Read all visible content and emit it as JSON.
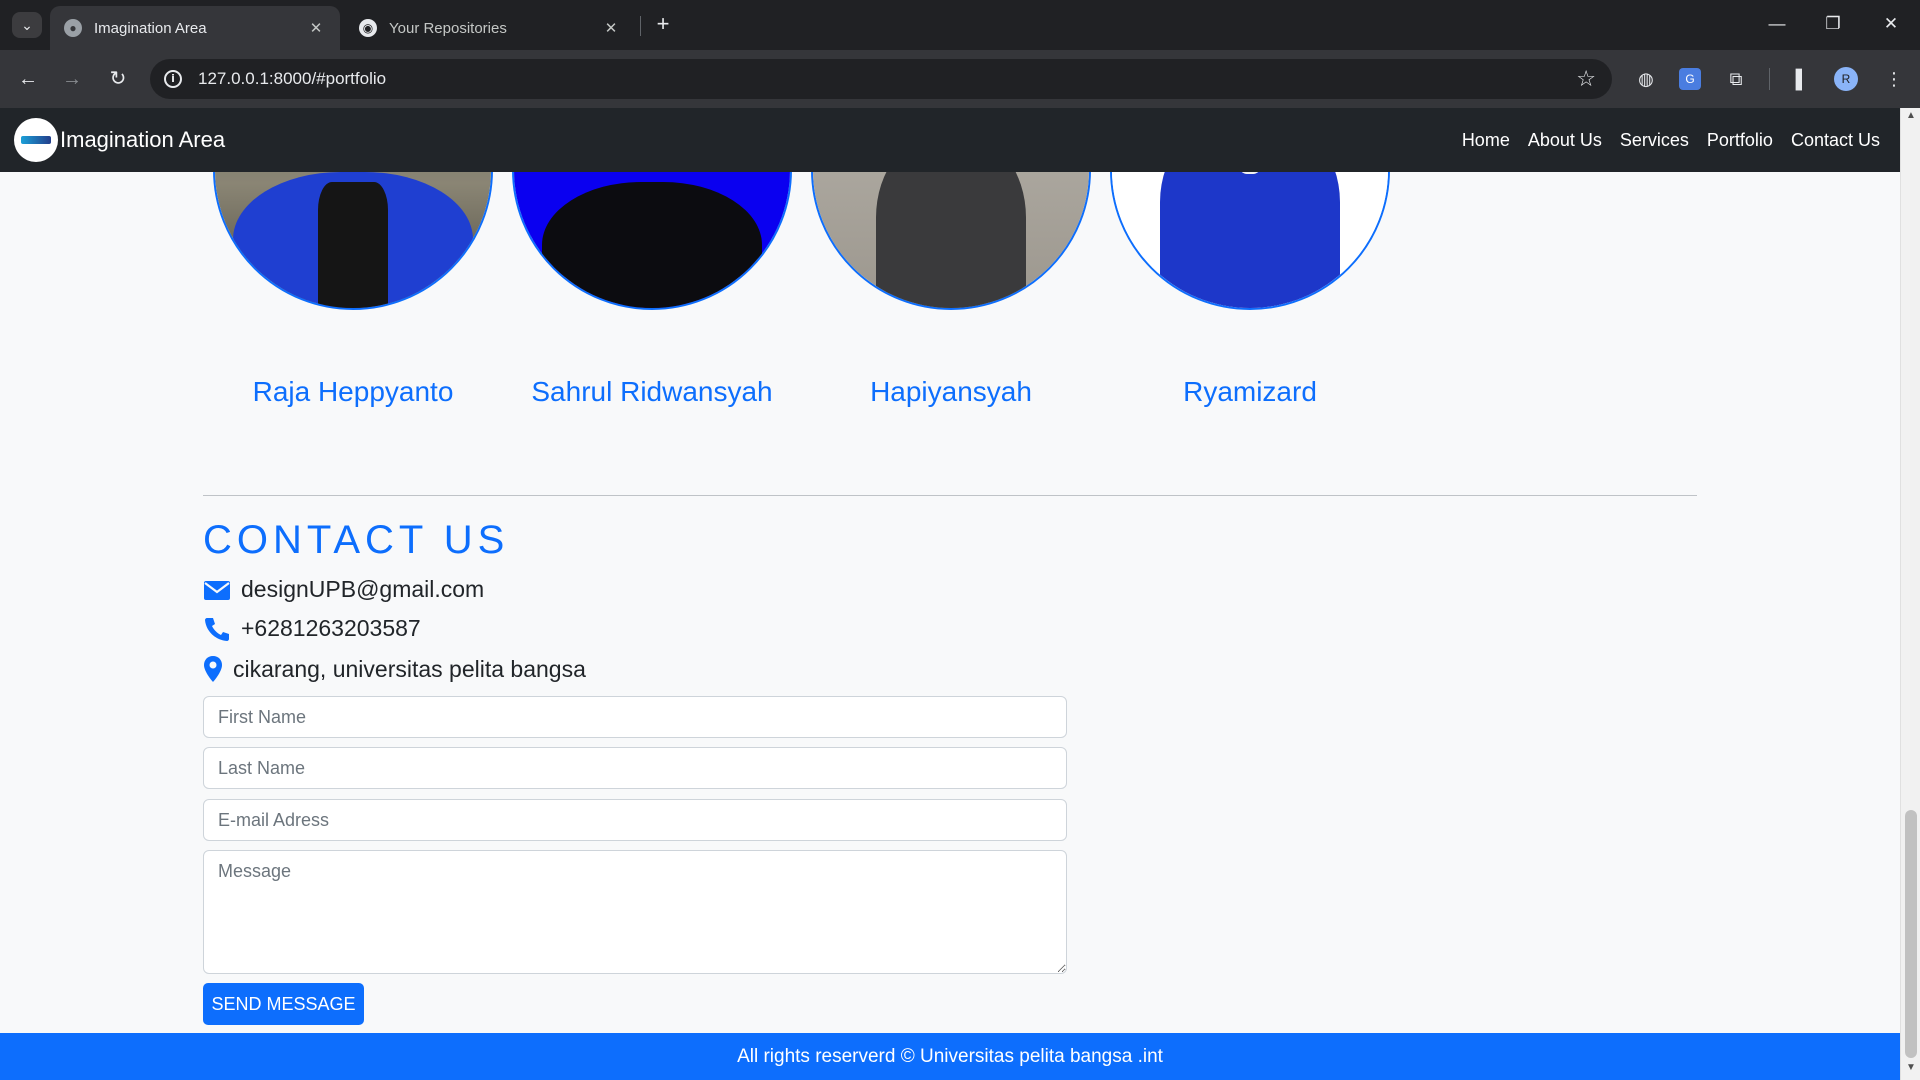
{
  "browser": {
    "tabs": [
      {
        "title": "Imagination Area",
        "icon": "globe-icon"
      },
      {
        "title": "Your Repositories",
        "icon": "github-icon"
      }
    ],
    "url": "127.0.0.1:8000/#portfolio",
    "profile_initial": "R"
  },
  "site": {
    "brand": "Imagination Area",
    "nav": [
      "Home",
      "About Us",
      "Services",
      "Portfolio",
      "Contact Us"
    ]
  },
  "team": [
    {
      "name": "Raja Heppyanto"
    },
    {
      "name": "Sahrul Ridwansyah"
    },
    {
      "name": "Hapiyansyah"
    },
    {
      "name": "Ryamizard"
    }
  ],
  "contact": {
    "title": "CONTACT US",
    "email": "designUPB@gmail.com",
    "phone": "+6281263203587",
    "address": "cikarang, universitas pelita bangsa",
    "form": {
      "first_name_placeholder": "First Name",
      "last_name_placeholder": "Last Name",
      "email_placeholder": "E-mail Adress",
      "message_placeholder": "Message",
      "submit_label": "SEND MESSAGE"
    }
  },
  "footer": "All rights reserverd © Universitas pelita bangsa .int",
  "colors": {
    "accent": "#0d6efd",
    "navbar": "#212529",
    "page_bg": "#f8f9fa"
  }
}
